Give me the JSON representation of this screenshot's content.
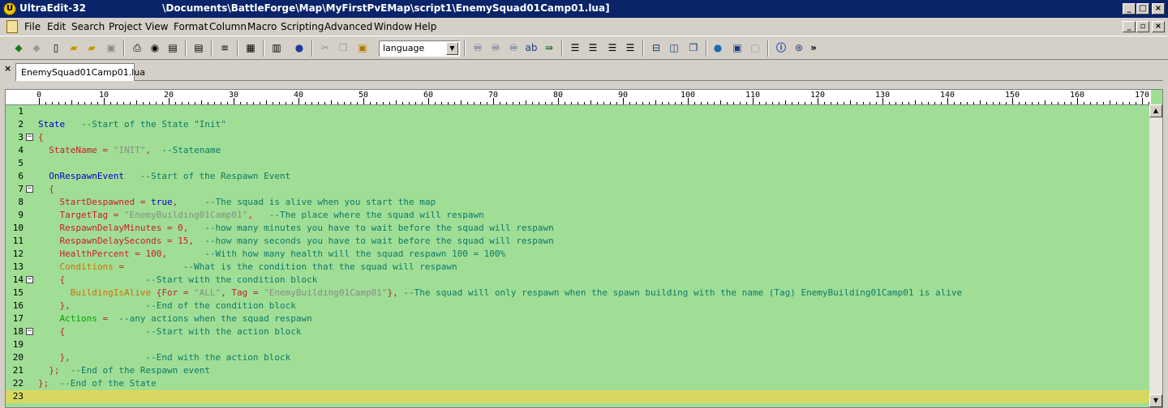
{
  "window": {
    "app_name": "UltraEdit-32",
    "path": "\\Documents\\BattleForge\\Map\\MyFirstPvEMap\\script1\\EnemySquad01Camp01.lua]"
  },
  "menu": [
    "File",
    "Edit",
    "Search",
    "Project",
    "View",
    "Format",
    "Column",
    "Macro",
    "Scripting",
    "Advanced",
    "Window",
    "Help"
  ],
  "toolbar": {
    "language_value": "language",
    "more": "»"
  },
  "tab": {
    "label": "EnemySquad01Camp01.lua",
    "close": "×"
  },
  "ruler": {
    "labels": [
      "0",
      "10",
      "20",
      "30",
      "40",
      "50",
      "60",
      "70",
      "80",
      "90",
      "100",
      "110",
      "120",
      "130",
      "140",
      "150",
      "160",
      "170"
    ]
  },
  "lines": [
    {
      "n": "1",
      "fold": false,
      "tokens": []
    },
    {
      "n": "2",
      "fold": false,
      "tokens": [
        [
          "k",
          "State"
        ],
        [
          "c",
          "   --Start of the State \"Init\""
        ]
      ]
    },
    {
      "n": "3",
      "fold": true,
      "tokens": [
        [
          "v",
          "{"
        ]
      ]
    },
    {
      "n": "4",
      "fold": false,
      "tokens": [
        [
          "v",
          "  StateName = "
        ],
        [
          "s",
          "\"INIT\""
        ],
        [
          "v",
          ",  "
        ],
        [
          "c",
          "--Statename"
        ]
      ]
    },
    {
      "n": "5",
      "fold": false,
      "tokens": []
    },
    {
      "n": "6",
      "fold": false,
      "tokens": [
        [
          "k",
          "  OnRespawnEvent"
        ],
        [
          "c",
          "   --Start of the Respawn Event"
        ]
      ]
    },
    {
      "n": "7",
      "fold": true,
      "tokens": [
        [
          "v",
          "  {"
        ]
      ]
    },
    {
      "n": "8",
      "fold": false,
      "tokens": [
        [
          "v",
          "    StartDespawned = "
        ],
        [
          "k",
          "true"
        ],
        [
          "v",
          ",     "
        ],
        [
          "c",
          "--The squad is alive when you start the map"
        ]
      ]
    },
    {
      "n": "9",
      "fold": false,
      "tokens": [
        [
          "v",
          "    TargetTag = "
        ],
        [
          "s",
          "\"EnemyBuilding01Camp01\""
        ],
        [
          "v",
          ",   "
        ],
        [
          "c",
          "--The place where the squad will respawn"
        ]
      ]
    },
    {
      "n": "10",
      "fold": false,
      "tokens": [
        [
          "v",
          "    RespawnDelayMinutes = 0,   "
        ],
        [
          "c",
          "--how many minutes you have to wait before the squad will respawn"
        ]
      ]
    },
    {
      "n": "11",
      "fold": false,
      "tokens": [
        [
          "v",
          "    RespawnDelaySeconds = 15,  "
        ],
        [
          "c",
          "--how many seconds you have to wait before the squad will respawn"
        ]
      ]
    },
    {
      "n": "12",
      "fold": false,
      "tokens": [
        [
          "v",
          "    HealthPercent = 100,       "
        ],
        [
          "c",
          "--With how many health will the squad respawn 100 = 100%"
        ]
      ]
    },
    {
      "n": "13",
      "fold": false,
      "tokens": [
        [
          "f",
          "    Conditions"
        ],
        [
          "v",
          " =           "
        ],
        [
          "c",
          "--What is the condition that the squad will respawn"
        ]
      ]
    },
    {
      "n": "14",
      "fold": true,
      "tokens": [
        [
          "v",
          "    {               "
        ],
        [
          "c",
          "--Start with the condition block"
        ]
      ]
    },
    {
      "n": "15",
      "fold": false,
      "tokens": [
        [
          "f",
          "      BuildingIsAlive"
        ],
        [
          "v",
          " {For = "
        ],
        [
          "s",
          "\"ALL\""
        ],
        [
          "v",
          ", Tag = "
        ],
        [
          "s",
          "\"EnemyBuilding01Camp01\""
        ],
        [
          "v",
          "}, "
        ],
        [
          "c",
          "--The squad will only respawn when the spawn building with the name (Tag) EnemyBuilding01Camp01 is alive"
        ]
      ]
    },
    {
      "n": "16",
      "fold": false,
      "tokens": [
        [
          "v",
          "    },              "
        ],
        [
          "c",
          "--End of the condition block"
        ]
      ]
    },
    {
      "n": "17",
      "fold": false,
      "tokens": [
        [
          "g2",
          "    Actions"
        ],
        [
          "v",
          " =  "
        ],
        [
          "c",
          "--any actions when the squad respawn"
        ]
      ]
    },
    {
      "n": "18",
      "fold": true,
      "tokens": [
        [
          "v",
          "    {               "
        ],
        [
          "c",
          "--Start with the action block"
        ]
      ]
    },
    {
      "n": "19",
      "fold": false,
      "tokens": []
    },
    {
      "n": "20",
      "fold": false,
      "tokens": [
        [
          "v",
          "    },              "
        ],
        [
          "c",
          "--End with the action block"
        ]
      ]
    },
    {
      "n": "21",
      "fold": false,
      "tokens": [
        [
          "v",
          "  };  "
        ],
        [
          "c",
          "--End of the Respawn event"
        ]
      ]
    },
    {
      "n": "22",
      "fold": false,
      "tokens": [
        [
          "v",
          "};  "
        ],
        [
          "c",
          "--End of the State"
        ]
      ]
    },
    {
      "n": "23",
      "fold": false,
      "current": true,
      "tokens": []
    }
  ]
}
